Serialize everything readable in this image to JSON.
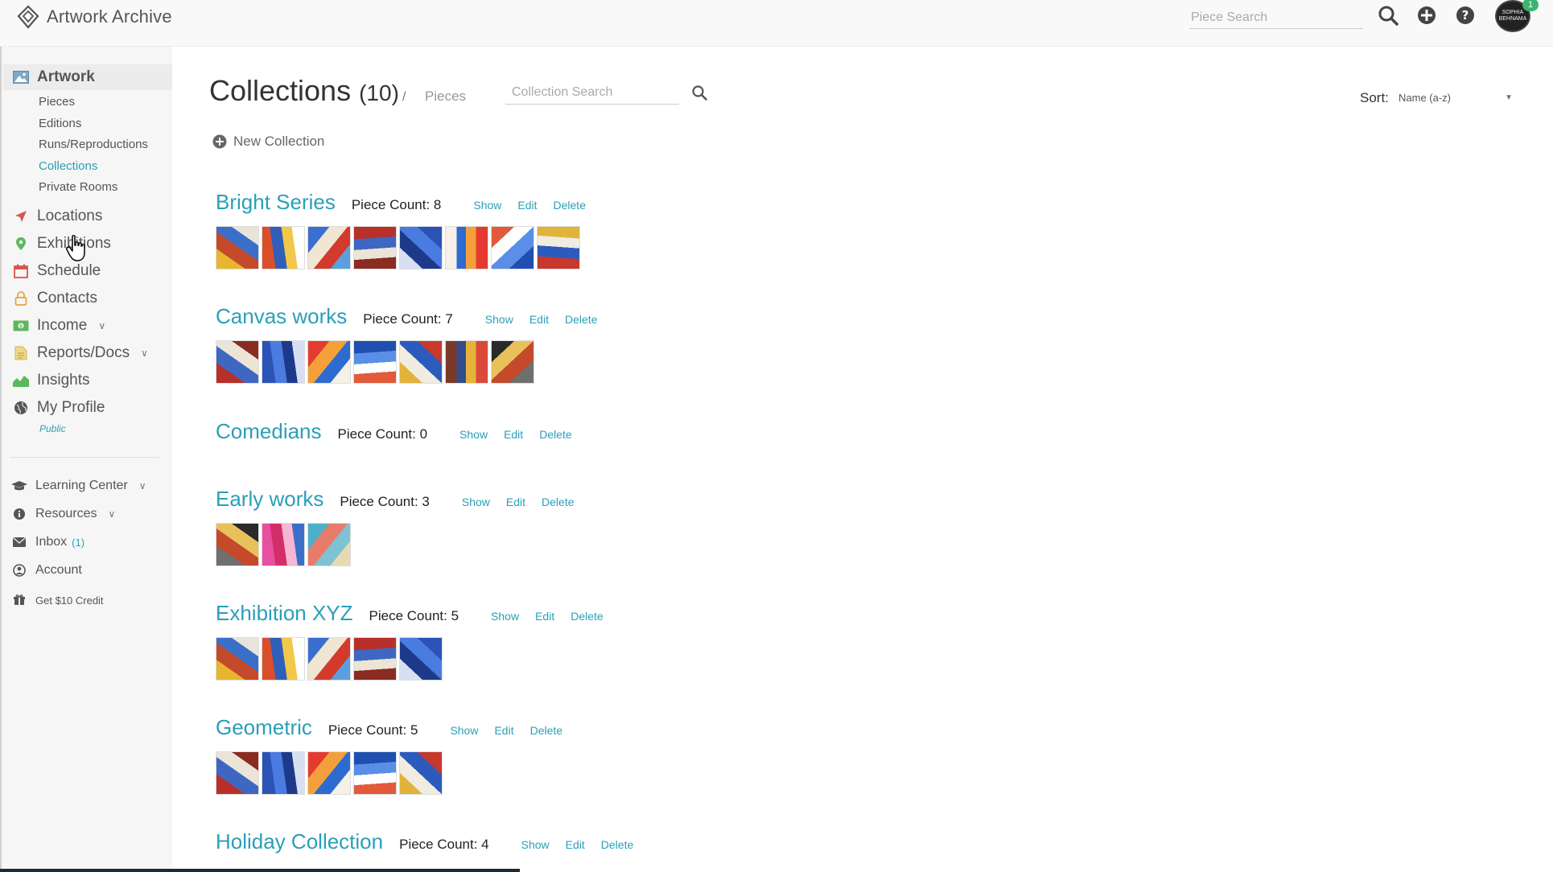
{
  "app": {
    "title": "Artwork Archive"
  },
  "topbar": {
    "piece_search_placeholder": "Piece Search",
    "avatar_badge": "1",
    "avatar_text": "SOPHIA BEHNAMA",
    "icons": [
      "search-icon",
      "plus-circle-icon",
      "help-icon",
      "avatar"
    ]
  },
  "sidebar": {
    "artwork": "Artwork",
    "sub": {
      "pieces": "Pieces",
      "editions": "Editions",
      "runs": "Runs/Reproductions",
      "collections": "Collections",
      "private_rooms": "Private Rooms"
    },
    "locations": "Locations",
    "exhibitions": "Exhibitions",
    "schedule": "Schedule",
    "contacts": "Contacts",
    "income": "Income",
    "reports": "Reports/Docs",
    "insights": "Insights",
    "my_profile": "My Profile",
    "public": "Public",
    "learning_center": "Learning Center",
    "resources": "Resources",
    "inbox": "Inbox",
    "inbox_count": "(1)",
    "account": "Account",
    "credit": "Get $10 Credit"
  },
  "main": {
    "title": "Collections",
    "title_count": "(10)",
    "breadcrumb_sep": "/",
    "breadcrumb_pieces": "Pieces",
    "collection_search_placeholder": "Collection Search",
    "sort_label": "Sort:",
    "sort_value": "Name (a-z)",
    "new_collection": "New Collection",
    "actions": {
      "show": "Show",
      "edit": "Edit",
      "delete": "Delete"
    }
  },
  "collections": [
    {
      "name": "Bright Series",
      "count_label": "Piece Count: 8",
      "thumb_count": 8
    },
    {
      "name": "Canvas works",
      "count_label": "Piece Count: 7",
      "thumb_count": 7
    },
    {
      "name": "Comedians",
      "count_label": "Piece Count: 0",
      "thumb_count": 0
    },
    {
      "name": "Early works",
      "count_label": "Piece Count: 3",
      "thumb_count": 3
    },
    {
      "name": "Exhibition XYZ",
      "count_label": "Piece Count: 5",
      "thumb_count": 5
    },
    {
      "name": "Geometric",
      "count_label": "Piece Count: 5",
      "thumb_count": 5
    },
    {
      "name": "Holiday Collection",
      "count_label": "Piece Count: 4",
      "thumb_count": 0
    }
  ],
  "colors": {
    "accent": "#2a9fb8",
    "text": "#333333",
    "sidebar_bg": "#f6f6f6"
  }
}
